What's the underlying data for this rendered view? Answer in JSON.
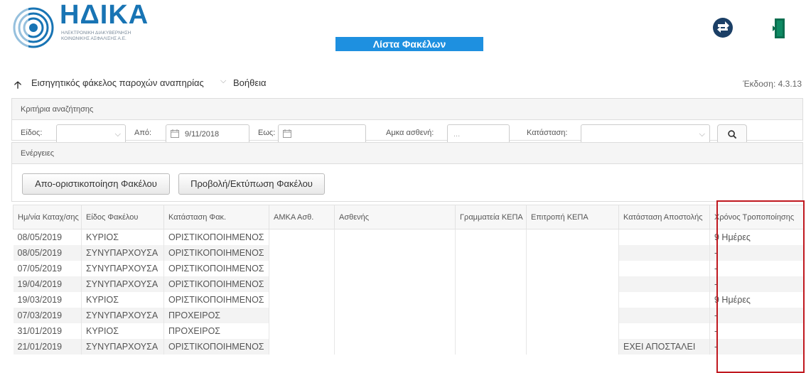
{
  "header": {
    "logo_title": "ΗΔΙΚΑ",
    "logo_sub_1": "ΗΛΕΚΤΡΟΝΙΚΗ ΔΙΑΚΥΒΕΡΝΗΣΗ",
    "logo_sub_2": "ΚΟΙΝΩΝΙΚΗΣ ΑΣΦΑΛΙΣΗΣ Α.Ε.",
    "page_title": "Λίστα Φακέλων",
    "colors": {
      "brand": "#1874b4",
      "title_bg": "#1e90e0"
    }
  },
  "menu": {
    "item_1": "Εισηγητικός φάκελος παροχών αναπηρίας",
    "item_2": "Βοήθεια",
    "version": "Έκδοση: 4.3.13"
  },
  "search": {
    "section_title": "Κριτήρια αναζήτησης",
    "type_label": "Είδος:",
    "from_label": "Από:",
    "from_value": "9/11/2018",
    "to_label": "Εως:",
    "amka_label": "Αμκα ασθενή:",
    "amka_placeholder": "...",
    "status_label": "Κατάσταση:"
  },
  "actions": {
    "section_title": "Ενέργειες",
    "btn_unfinalize": "Απο-οριστικοποίηση Φακέλου",
    "btn_view_print": "Προβολή/Εκτύπωση Φακέλου"
  },
  "table": {
    "columns": [
      "Ημ/νία Καταχ/σης",
      "Είδος Φακέλου",
      "Κατάσταση Φακ.",
      "ΑΜΚΑ Ασθ.",
      "Ασθενής",
      "Γραμματεία ΚΕΠΑ",
      "Επιτροπή ΚΕΠΑ",
      "Κατάσταση Αποστολής",
      "Χρόνος Τροποποίησης"
    ],
    "rows": [
      [
        "08/05/2019",
        "ΚΥΡΙΟΣ",
        "ΟΡΙΣΤΙΚΟΠΟΙΗΜΕΝΟΣ",
        "",
        "",
        "",
        "",
        "",
        "9 Ημέρες"
      ],
      [
        "08/05/2019",
        "ΣΥΝΥΠΑΡΧΟΥΣΑ",
        "ΟΡΙΣΤΙΚΟΠΟΙΗΜΕΝΟΣ",
        "",
        "",
        "",
        "",
        "",
        "-"
      ],
      [
        "07/05/2019",
        "ΣΥΝΥΠΑΡΧΟΥΣΑ",
        "ΟΡΙΣΤΙΚΟΠΟΙΗΜΕΝΟΣ",
        "",
        "",
        "",
        "",
        "",
        "-"
      ],
      [
        "19/04/2019",
        "ΣΥΝΥΠΑΡΧΟΥΣΑ",
        "ΟΡΙΣΤΙΚΟΠΟΙΗΜΕΝΟΣ",
        "",
        "",
        "",
        "",
        "",
        "-"
      ],
      [
        "19/03/2019",
        "ΚΥΡΙΟΣ",
        "ΟΡΙΣΤΙΚΟΠΟΙΗΜΕΝΟΣ",
        "",
        "",
        "",
        "",
        "",
        "9 Ημέρες"
      ],
      [
        "07/03/2019",
        "ΣΥΝΥΠΑΡΧΟΥΣΑ",
        "ΠΡΟΧΕΙΡΟΣ",
        "",
        "",
        "",
        "",
        "",
        "-"
      ],
      [
        "31/01/2019",
        "ΚΥΡΙΟΣ",
        "ΠΡΟΧΕΙΡΟΣ",
        "",
        "",
        "",
        "",
        "",
        "-"
      ],
      [
        "21/01/2019",
        "ΣΥΝΥΠΑΡΧΟΥΣΑ",
        "ΟΡΙΣΤΙΚΟΠΟΙΗΜΕΝΟΣ",
        "",
        "",
        "",
        "",
        "ΕΧΕΙ ΑΠΟΣΤΑΛΕΙ",
        "-"
      ]
    ]
  }
}
